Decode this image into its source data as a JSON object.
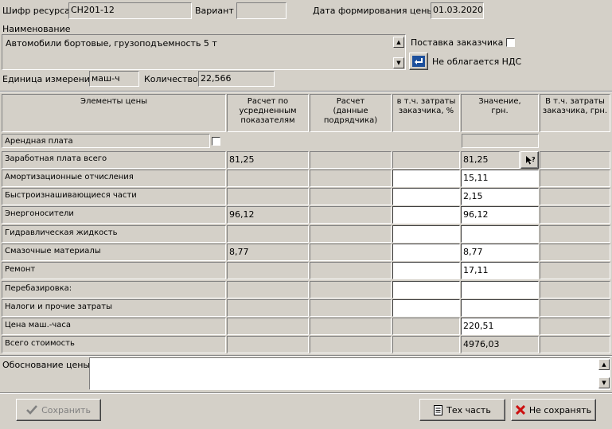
{
  "header": {
    "resource_code_label": "Шифр ресурса",
    "resource_code_value": "СН201-12",
    "variant_label": "Вариант",
    "variant_value": "",
    "price_date_label": "Дата формирования цены",
    "price_date_value": "01.03.2020",
    "name_label": "Наименование",
    "name_value": "Автомобили бортовые, грузоподъемность 5 т",
    "customer_supply_label": "Поставка заказчика",
    "vat_label": "Не облагается НДС",
    "unit_label": "Единица измерения",
    "unit_value": "маш-ч",
    "quantity_label": "Количество",
    "quantity_value": "22,566"
  },
  "table": {
    "columns": [
      "Элементы цены",
      "Расчет по\nусредненным\nпоказателям",
      "Расчет\n(данные\nподрядчика)",
      "в т.ч. затраты\nзаказчика, %",
      "Значение,\nгрн.",
      "В т.ч. затраты\nзаказчика, грн."
    ],
    "rows": [
      {
        "label": "Арендная плата",
        "avg": "",
        "contractor": "",
        "customer_pct": "",
        "value": "",
        "customer_uah": ""
      },
      {
        "label": "Заработная плата всего",
        "avg": "81,25",
        "contractor": "",
        "customer_pct": "",
        "value": "81,25",
        "customer_uah": ""
      },
      {
        "label": "Амортизационные отчисления",
        "avg": "",
        "contractor": "",
        "customer_pct": "",
        "value": "15,11",
        "customer_uah": ""
      },
      {
        "label": "Быстроизнашивающиеся части",
        "avg": "",
        "contractor": "",
        "customer_pct": "",
        "value": "2,15",
        "customer_uah": ""
      },
      {
        "label": "Энергоносители",
        "avg": "96,12",
        "contractor": "",
        "customer_pct": "",
        "value": "96,12",
        "customer_uah": ""
      },
      {
        "label": "Гидравлическая жидкость",
        "avg": "",
        "contractor": "",
        "customer_pct": "",
        "value": "",
        "customer_uah": ""
      },
      {
        "label": "Смазочные материалы",
        "avg": "8,77",
        "contractor": "",
        "customer_pct": "",
        "value": "8,77",
        "customer_uah": ""
      },
      {
        "label": "Ремонт",
        "avg": "",
        "contractor": "",
        "customer_pct": "",
        "value": "17,11",
        "customer_uah": ""
      },
      {
        "label": "Перебазировка:",
        "avg": "",
        "contractor": "",
        "customer_pct": "",
        "value": "",
        "customer_uah": ""
      },
      {
        "label": "Налоги и прочие затраты",
        "avg": "",
        "contractor": "",
        "customer_pct": "",
        "value": "",
        "customer_uah": ""
      },
      {
        "label": "Цена маш.-часа",
        "avg": "",
        "contractor": "",
        "customer_pct": "",
        "value": "220,51",
        "customer_uah": ""
      },
      {
        "label": "Всего стоимость",
        "avg": "",
        "contractor": "",
        "customer_pct": "",
        "value": "4976,03",
        "customer_uah": ""
      }
    ]
  },
  "justification": {
    "label": "Обоснование цены",
    "value": ""
  },
  "buttons": {
    "save": "Сохранить",
    "tech_part": "Тех часть",
    "dont_save": "Не сохранять"
  },
  "colors": {
    "window_bg": "#d4d0c8",
    "field_bg": "#ffffff",
    "save_icon": "#4a7a3a",
    "cancel_icon": "#cc1010",
    "vat_icon": "#1c4f9c"
  },
  "icons": {
    "save": "checkmark-icon",
    "tech_part": "document-icon",
    "dont_save": "x-icon",
    "vat": "arrow-return-icon",
    "value_help": "pointer-help-icon"
  }
}
